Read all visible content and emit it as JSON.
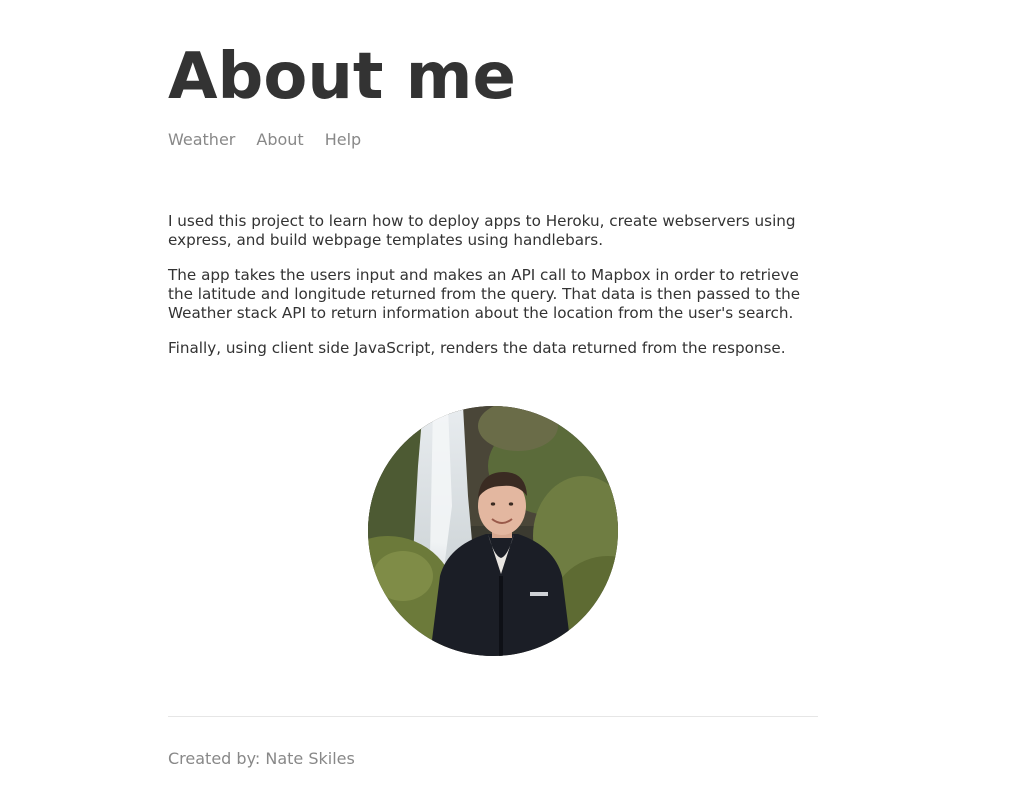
{
  "header": {
    "title": "About me"
  },
  "nav": {
    "items": [
      {
        "label": "Weather"
      },
      {
        "label": "About"
      },
      {
        "label": "Help"
      }
    ]
  },
  "main": {
    "paragraphs": [
      "I used this project to learn how to deploy apps to Heroku, create webservers using express, and build webpage templates using handlebars.",
      "The app takes the users input and makes an API call to Mapbox in order to retrieve the latitude and longitude returned from the query. That data is then passed to the Weather stack API to return information about the location from the user's search.",
      "Finally, using client side JavaScript, renders the data returned from the response."
    ]
  },
  "footer": {
    "text": "Created by: Nate Skiles"
  }
}
